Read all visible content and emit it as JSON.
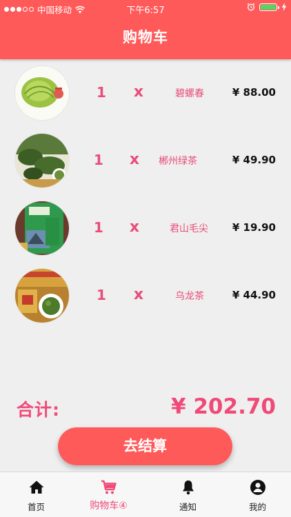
{
  "status_bar": {
    "carrier": "中国移动",
    "time": "下午6:57",
    "battery_level": 1.0
  },
  "header": {
    "title": "购物车"
  },
  "cart": {
    "items": [
      {
        "quantity": "1",
        "times": "x",
        "name": "碧螺春",
        "price": "¥ 88.00"
      },
      {
        "quantity": "1",
        "times": "x",
        "name": "郴州绿茶",
        "price": "¥ 49.90"
      },
      {
        "quantity": "1",
        "times": "x",
        "name": "君山毛尖",
        "price": "¥ 19.90"
      },
      {
        "quantity": "1",
        "times": "x",
        "name": "乌龙茶",
        "price": "¥ 44.90"
      }
    ],
    "total_label": "合计:",
    "total_value": "¥ 202.70",
    "checkout_label": "去结算"
  },
  "tabbar": {
    "tabs": [
      {
        "label": "首页",
        "icon": "home-icon"
      },
      {
        "label": "购物车④",
        "icon": "cart-icon"
      },
      {
        "label": "通知",
        "icon": "bell-icon"
      },
      {
        "label": "我的",
        "icon": "user-icon"
      }
    ],
    "active_color": "#ef4a78"
  },
  "colors": {
    "brand": "#ff5a5a",
    "accent": "#ef4a78",
    "background": "#efefef"
  }
}
